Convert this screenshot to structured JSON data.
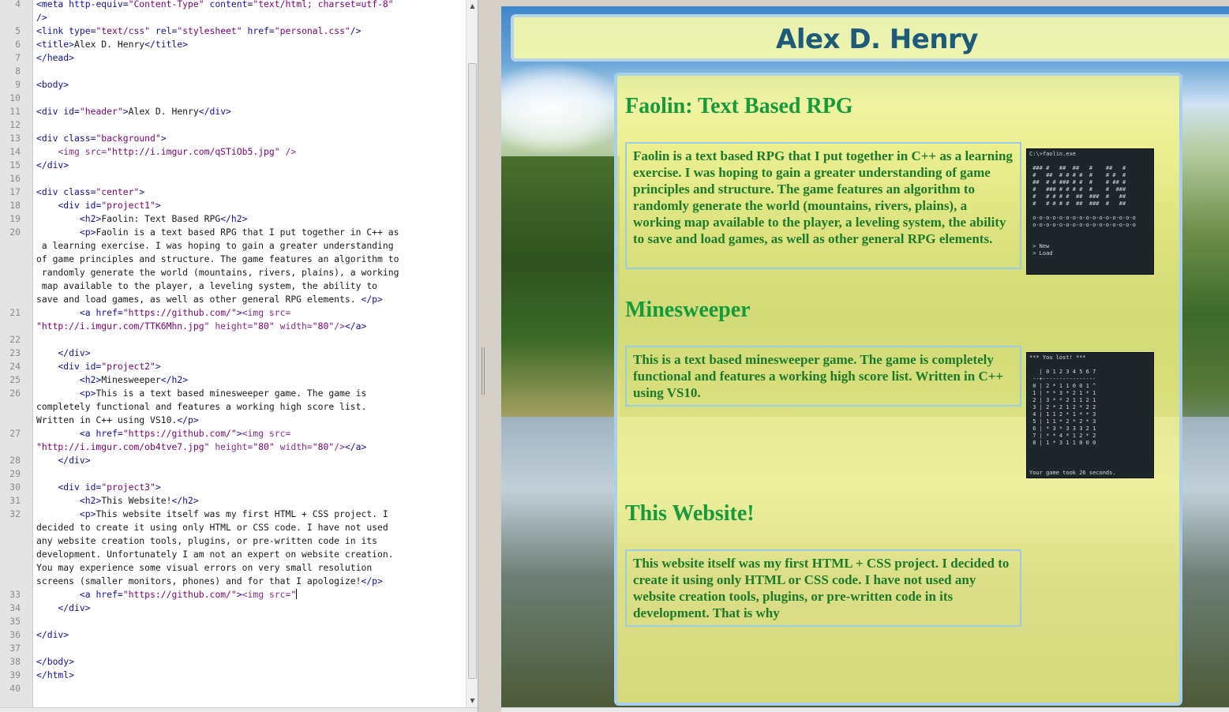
{
  "editor": {
    "lines": [
      {
        "num": "4",
        "html": "<span class='t-tag'>&lt;meta</span> <span class='t-attr'>http-equiv=</span><span class='t-str'>\"Content-Type\"</span> <span class='t-attr'>content=</span><span class='t-str'>\"text/html; charset=utf-8\"</span>"
      },
      {
        "num": "",
        "html": "<span class='t-tag'>/&gt;</span>"
      },
      {
        "num": "5",
        "html": "<span class='t-tag'>&lt;link</span> <span class='t-attr'>type=</span><span class='t-str'>\"text/css\"</span> <span class='t-attr'>rel=</span><span class='t-str'>\"stylesheet\"</span> <span class='t-attr'>href=</span><span class='t-str'>\"personal.css\"</span><span class='t-tag'>/&gt;</span>"
      },
      {
        "num": "6",
        "html": "<span class='t-tag'>&lt;title&gt;</span>Alex D. Henry<span class='t-tag'>&lt;/title&gt;</span>"
      },
      {
        "num": "7",
        "html": "<span class='t-tag'>&lt;/head&gt;</span>"
      },
      {
        "num": "8",
        "html": ""
      },
      {
        "num": "9",
        "html": "<span class='t-tag'>&lt;body&gt;</span>"
      },
      {
        "num": "10",
        "html": ""
      },
      {
        "num": "11",
        "html": "<span class='t-tag'>&lt;div</span> <span class='t-attr'>id=</span><span class='t-str'>\"header\"</span><span class='t-tag'>&gt;</span>Alex D. Henry<span class='t-tag'>&lt;/div&gt;</span>"
      },
      {
        "num": "12",
        "html": ""
      },
      {
        "num": "13",
        "html": "<span class='t-tag'>&lt;div</span> <span class='t-attr'>class=</span><span class='t-str'>\"background\"</span><span class='t-tag'>&gt;</span>"
      },
      {
        "num": "14",
        "html": "    <span class='t-img'>&lt;img</span> <span class='t-img'>src=</span><span class='t-str'>\"http://i.imgur.com/qSTiOb5.jpg\"</span> <span class='t-img'>/&gt;</span>"
      },
      {
        "num": "15",
        "html": "<span class='t-tag'>&lt;/div&gt;</span>"
      },
      {
        "num": "16",
        "html": ""
      },
      {
        "num": "17",
        "html": "<span class='t-tag'>&lt;div</span> <span class='t-attr'>class=</span><span class='t-str'>\"center\"</span><span class='t-tag'>&gt;</span>"
      },
      {
        "num": "18",
        "html": "    <span class='t-tag'>&lt;div</span> <span class='t-attr'>id=</span><span class='t-str'>\"project1\"</span><span class='t-tag'>&gt;</span>"
      },
      {
        "num": "19",
        "html": "        <span class='t-tag'>&lt;h2&gt;</span>Faolin: Text Based RPG<span class='t-tag'>&lt;/h2&gt;</span>"
      },
      {
        "num": "20",
        "html": "        <span class='t-tag'>&lt;p&gt;</span>Faolin is a text based RPG that I put together in C++ as"
      },
      {
        "num": "",
        "html": " a learning exercise. I was hoping to gain a greater understanding"
      },
      {
        "num": "",
        "html": "of game principles and structure. The game features an algorithm to"
      },
      {
        "num": "",
        "html": " randomly generate the world (mountains, rivers, plains), a working"
      },
      {
        "num": "",
        "html": " map available to the player, a leveling system, the ability to"
      },
      {
        "num": "",
        "html": "save and load games, as well as other general RPG elements. <span class='t-tag'>&lt;/p&gt;</span>"
      },
      {
        "num": "21",
        "html": "        <span class='t-tag'>&lt;a</span> <span class='t-attr'>href=</span><span class='t-str'>\"https://github.com/\"</span><span class='t-tag'>&gt;</span><span class='t-img'>&lt;img src=</span>"
      },
      {
        "num": "",
        "html": "<span class='t-str'>\"http://i.imgur.com/TTK6Mhn.jpg\"</span> <span class='t-img'>height=</span><span class='t-str'>\"80\"</span> <span class='t-img'>width=</span><span class='t-str'>\"80\"</span><span class='t-img'>/&gt;</span><span class='t-tag'>&lt;/a&gt;</span>"
      },
      {
        "num": "22",
        "html": ""
      },
      {
        "num": "23",
        "html": "    <span class='t-tag'>&lt;/div&gt;</span>"
      },
      {
        "num": "24",
        "html": "    <span class='t-tag'>&lt;div</span> <span class='t-attr'>id=</span><span class='t-str'>\"project2\"</span><span class='t-tag'>&gt;</span>"
      },
      {
        "num": "25",
        "html": "        <span class='t-tag'>&lt;h2&gt;</span>Minesweeper<span class='t-tag'>&lt;/h2&gt;</span>"
      },
      {
        "num": "26",
        "html": "        <span class='t-tag'>&lt;p&gt;</span>This is a text based minesweeper game. The game is"
      },
      {
        "num": "",
        "html": "completely functional and features a working high score list."
      },
      {
        "num": "",
        "html": "Written in C++ using VS10.<span class='t-tag'>&lt;/p&gt;</span>"
      },
      {
        "num": "27",
        "html": "        <span class='t-tag'>&lt;a</span> <span class='t-attr'>href=</span><span class='t-str'>\"https://github.com/\"</span><span class='t-tag'>&gt;</span><span class='t-img'>&lt;img src=</span>"
      },
      {
        "num": "",
        "html": "<span class='t-str'>\"http://i.imgur.com/ob4tve7.jpg\"</span> <span class='t-img'>height=</span><span class='t-str'>\"80\"</span> <span class='t-img'>width=</span><span class='t-str'>\"80\"</span><span class='t-img'>/&gt;</span><span class='t-tag'>&lt;/a&gt;</span>"
      },
      {
        "num": "28",
        "html": "    <span class='t-tag'>&lt;/div&gt;</span>"
      },
      {
        "num": "29",
        "html": ""
      },
      {
        "num": "30",
        "html": "    <span class='t-tag'>&lt;div</span> <span class='t-attr'>id=</span><span class='t-str'>\"project3\"</span><span class='t-tag'>&gt;</span>"
      },
      {
        "num": "31",
        "html": "        <span class='t-tag'>&lt;h2&gt;</span>This Website!<span class='t-tag'>&lt;/h2&gt;</span>"
      },
      {
        "num": "32",
        "html": "        <span class='t-tag'>&lt;p&gt;</span>This website itself was my first HTML + CSS project. I"
      },
      {
        "num": "",
        "html": "decided to create it using only HTML or CSS code. I have not used"
      },
      {
        "num": "",
        "html": "any website creation tools, plugins, or pre-written code in its"
      },
      {
        "num": "",
        "html": "development. Unfortunately I am not an expert on website creation."
      },
      {
        "num": "",
        "html": "You may experience some visual errors on very small resolution"
      },
      {
        "num": "",
        "html": "screens (smaller monitors, phones) and for that I apologize!<span class='t-tag'>&lt;/p&gt;</span>"
      },
      {
        "num": "33",
        "html": "        <span class='t-tag'>&lt;a</span> <span class='t-attr'>href=</span><span class='t-str'>\"https://github.com/\"</span><span class='t-tag'>&gt;</span><span class='t-img'>&lt;img src=</span><span class='t-str'>\"</span><span id='caret'></span>"
      },
      {
        "num": "34",
        "html": "    <span class='t-tag'>&lt;/div&gt;</span>"
      },
      {
        "num": "35",
        "html": ""
      },
      {
        "num": "36",
        "html": "<span class='t-tag'>&lt;/div&gt;</span>"
      },
      {
        "num": "37",
        "html": ""
      },
      {
        "num": "38",
        "html": "<span class='t-tag'>&lt;/body&gt;</span>"
      },
      {
        "num": "39",
        "html": "<span class='t-tag'>&lt;/html&gt;</span>"
      },
      {
        "num": "40",
        "html": ""
      }
    ],
    "scroll_up_glyph": "▲",
    "scroll_down_glyph": "▼",
    "splitter_glyph": "≡"
  },
  "preview": {
    "header": "Alex D. Henry",
    "projects": [
      {
        "title": "Faolin: Text Based RPG",
        "text": "Faolin is a text based RPG that I put together in C++ as a learning exercise. I was hoping to gain a greater understanding of game principles and structure. The game features an algorithm to randomly generate the world (mountains, rivers, plains), a working map available to the player, a leveling system, the ability to save and load games, as well as other general RPG elements.",
        "image_label": "faolin-screenshot"
      },
      {
        "title": "Minesweeper",
        "text": "This is a text based minesweeper game. The game is completely functional and features a working high score list. Written in C++ using VS10.",
        "image_label": "minesweeper-screenshot",
        "image_caption": "Your game took 26 seconds."
      },
      {
        "title": "This Website!",
        "text": "This website itself was my first HTML + CSS project. I decided to create it using only HTML or CSS code. I have not used any website creation tools, plugins, or pre-written code in its development. That is why"
      }
    ]
  },
  "colors": {
    "header_text": "#1e5a7a",
    "project_title": "#159a3c",
    "project_text": "#1d7a2a",
    "panel_border": "#a9d0ea"
  }
}
